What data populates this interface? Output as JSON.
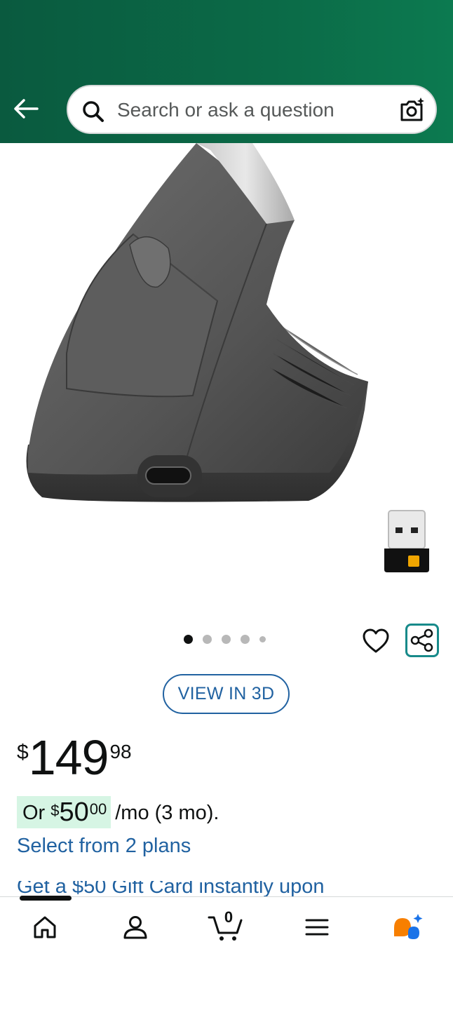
{
  "header": {
    "search_placeholder": "Search or ask a question"
  },
  "carousel": {
    "total_dots": 5,
    "active_index": 0
  },
  "actions": {
    "view_3d_label": "VIEW IN 3D"
  },
  "price": {
    "symbol": "$",
    "whole": "149",
    "fraction": "98"
  },
  "monthly": {
    "or_label": "Or",
    "symbol": "$",
    "whole": "50",
    "fraction": "00",
    "suffix": "/mo (3 mo)."
  },
  "links": {
    "plans": "Select from 2 plans",
    "gift_card": "Get a $50 Gift Card instantly upon"
  },
  "bottom_nav": {
    "cart_count": "0",
    "items": [
      "home-icon",
      "account-icon",
      "cart-icon",
      "menu-icon",
      "rufus-icon"
    ]
  },
  "colors": {
    "header_start": "#0a5a3f",
    "header_end": "#0c7a50",
    "link": "#2162a1",
    "share_border": "#178a8a",
    "highlight": "#d6f5e4",
    "rufus_orange": "#f77f00",
    "rufus_blue": "#1a73e8"
  }
}
